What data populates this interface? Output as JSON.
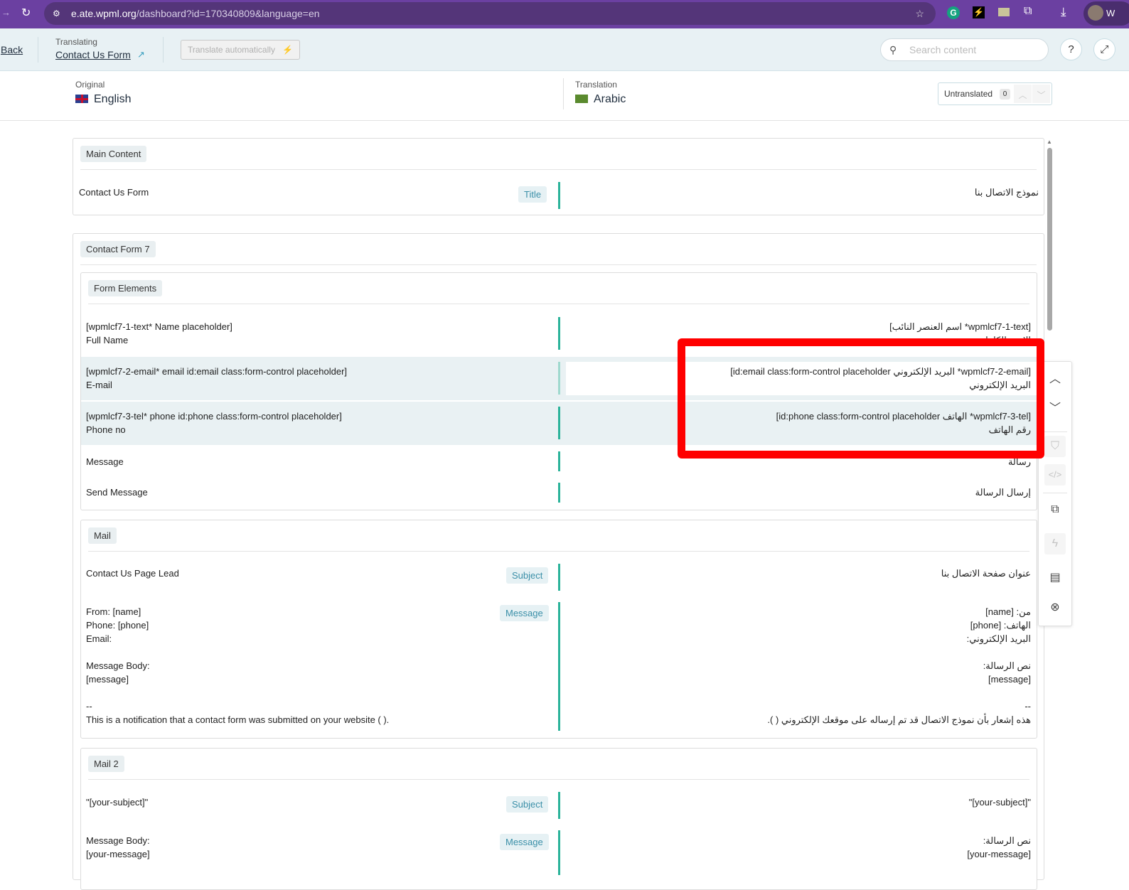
{
  "browser": {
    "url_host": "e.ate.wpml.org",
    "url_path": "/dashboard?id=170340809&language=en",
    "profile_initial": "W"
  },
  "header": {
    "back": "Back",
    "translating_label": "Translating",
    "doc_title": "Contact Us Form",
    "translate_auto": "Translate automatically",
    "search_placeholder": "Search content"
  },
  "languages": {
    "original_label": "Original",
    "original": "English",
    "translation_label": "Translation",
    "translation": "Arabic",
    "untranslated_label": "Untranslated",
    "untranslated_count": "0"
  },
  "sections": {
    "main": {
      "title": "Main Content",
      "row": {
        "src": "Contact Us Form",
        "label": "Title",
        "tr": "نموذج الاتصال بنا"
      }
    },
    "cf7": {
      "title": "Contact Form 7"
    },
    "form": {
      "title": "Form Elements",
      "rows": [
        {
          "src1": "[wpmlcf7-1-text* Name placeholder]",
          "src2": "Full Name",
          "tr1": "[wpmlcf7-1-text* اسم العنصر النائب]",
          "tr2": "الاسم الكامل"
        },
        {
          "src1": "[wpmlcf7-2-email* email id:email class:form-control placeholder]",
          "src2": "E-mail",
          "tr1": "[wpmlcf7-2-email* البريد الإلكتروني id:email class:form-control placeholder]",
          "tr2": "البريد الإلكتروني"
        },
        {
          "src1": "[wpmlcf7-3-tel* phone id:phone class:form-control placeholder]",
          "src2": "Phone no",
          "tr1": "[wpmlcf7-3-tel* الهاتف id:phone class:form-control placeholder]",
          "tr2": "رقم الهاتف"
        },
        {
          "src1": "Message",
          "tr1": "رسالة"
        },
        {
          "src1": "Send Message",
          "tr1": "إرسال الرسالة"
        }
      ]
    },
    "mail": {
      "title": "Mail",
      "subject": {
        "src": "Contact Us Page Lead",
        "label": "Subject",
        "tr": "عنوان صفحة الاتصال بنا"
      },
      "message": {
        "label": "Message",
        "src": [
          "From: [name]",
          "Phone: [phone]",
          "Email:",
          "",
          "Message Body:",
          "[message]",
          "",
          "--",
          "This is a notification that a contact form was submitted on your website ( )."
        ],
        "tr": [
          "من: [name]",
          "الهاتف: [phone]",
          "البريد الإلكتروني:",
          "",
          "نص الرسالة:",
          "[message]",
          "",
          "--",
          "هذه إشعار بأن نموذج الاتصال قد تم إرساله على موقعك الإلكتروني ( )."
        ]
      }
    },
    "mail2": {
      "title": "Mail 2",
      "subject": {
        "src": "\"[your-subject]\"",
        "label": "Subject",
        "tr": "\"[your-subject]\""
      },
      "message": {
        "label": "Message",
        "src": [
          "Message Body:",
          "[your-message]"
        ],
        "tr": [
          "نص الرسالة:",
          "[your-message]"
        ]
      }
    }
  },
  "colors": {
    "accent": "#2bb39a",
    "highlight": "#ff0000",
    "browser": "#6b40a1"
  }
}
